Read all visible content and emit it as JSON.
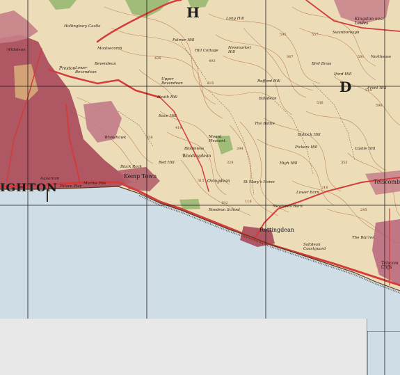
{
  "map": {
    "sheet_letters": [
      "H",
      "D"
    ],
    "labels": {
      "brighton": "IGHTON",
      "kemp_town": "Kemp Town",
      "rottingdean": "Rottingdean",
      "ovingdean": "Ovingdean",
      "woodingdean": "Woodingdean",
      "telscombe": "Telscomb",
      "telscombe_cliffs": "Telscom Cliffs",
      "kingston": "Kingston near Lewes",
      "falmer_hill": "Falmer Hill",
      "hill_cottage": "Hill Cottage",
      "newmarket_hill": "Newmarket Hill",
      "upper_bevendean": "Upper Bevendean",
      "lower_bevendean": "Lower Bevendean",
      "bevendean": "Bevendean",
      "preston": "Preston",
      "hollingbury": "Hollingbury Castle",
      "racehill": "Race Hill",
      "heath_hill": "Heath Hill",
      "balsdean": "Balsdean",
      "rufford_hill": "Rufford Hill",
      "high_hill": "High Hill",
      "mount_pleasant": "Mount Pleasant",
      "bloomless": "Bloomless",
      "whitehawk": "Whitehawk",
      "black_rock": "Black Rock",
      "palace_pier": "Palace Pier",
      "aquarium": "Aquarium",
      "marine_pde": "Marine Pde",
      "red_hill": "Red Hill",
      "st_marys_home": "St Mary's Home",
      "lower_barn": "Lower Barn",
      "newlands_barn": "Newlands Barn",
      "saltdean": "Saltdean Coastguard",
      "the_warren": "The Warren",
      "iford_hill": "Iford Hill",
      "front_hill": "Front Hill",
      "bullock_hill": "Bullock Hill",
      "pickers_hill": "Pickers Hill",
      "castle_hill": "Castle Hill",
      "bird_brow": "Bird Brow",
      "northease": "Northease",
      "swanborough": "Swanborough",
      "the_bottle": "The Bottle",
      "roedean": "Roedean School",
      "withdean": "Withdean",
      "moulsecoomb": "Moulsecomb",
      "long_hill": "Long Hill",
      "castle_hill_num": "595",
      "h1": "595",
      "h2": "493",
      "h3": "625",
      "h4": "557",
      "h5": "394",
      "h6": "216",
      "h7": "518",
      "h8": "419",
      "h9": "536",
      "h10": "328",
      "h11": "315",
      "h12": "245",
      "h13": "192",
      "h14": "118",
      "h15": "353",
      "h16": "598",
      "h17": "367",
      "h18": "426",
      "h19": "591",
      "h20": "258"
    }
  },
  "colors": {
    "land": "#ecdcb8",
    "sea": "#cfdde6",
    "contour": "#b06a3c",
    "urban": "#a8485a",
    "road": "#d23c3a",
    "woods": "#8fb368",
    "grid": "#1a1a1a",
    "margin": "#e8e8e8"
  }
}
